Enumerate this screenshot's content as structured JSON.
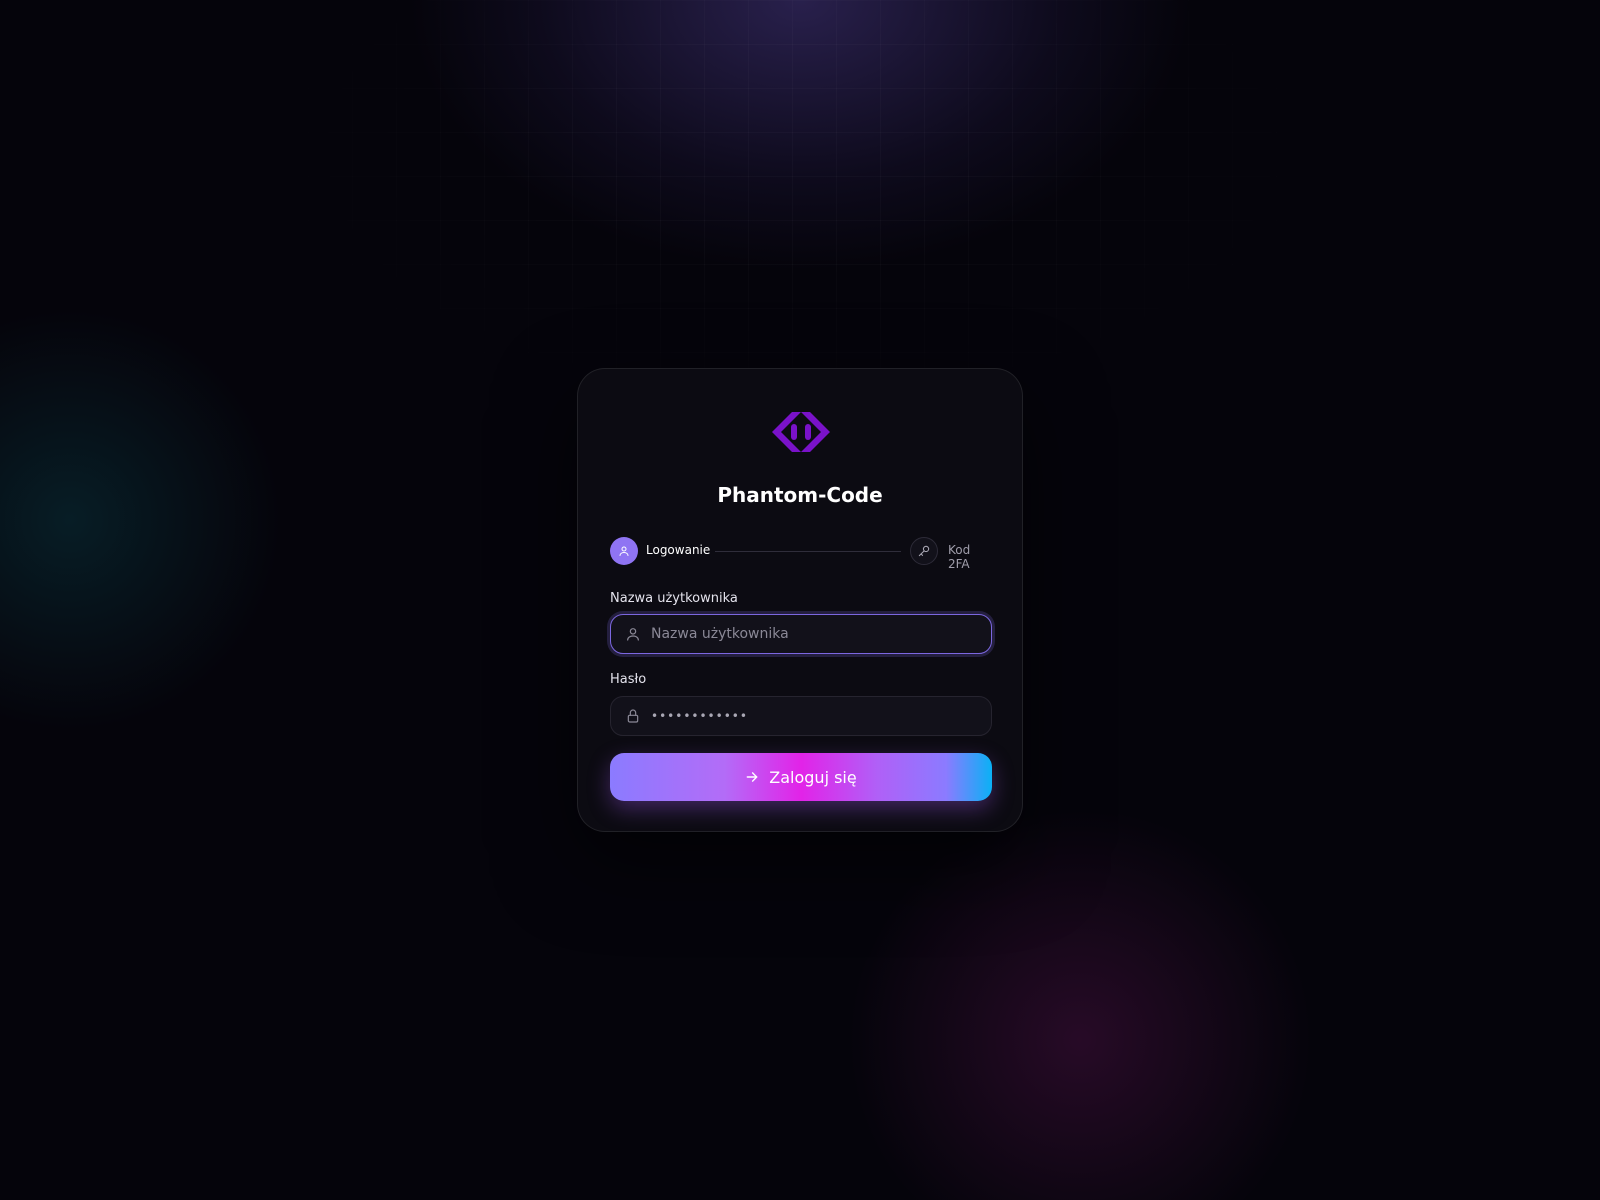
{
  "app": {
    "title": "Phantom-Code",
    "logo_icon": "code-brackets-logo",
    "accent_color": "#7a12c9"
  },
  "steps": [
    {
      "label": "Logowanie",
      "icon": "user-icon",
      "active": true
    },
    {
      "label": "Kod 2FA",
      "icon": "key-icon",
      "active": false
    }
  ],
  "form": {
    "username": {
      "label": "Nazwa użytkownika",
      "placeholder": "Nazwa użytkownika",
      "value": "",
      "icon": "user-icon"
    },
    "password": {
      "label": "Hasło",
      "value": "••••••••••••",
      "icon": "lock-icon"
    },
    "submit": {
      "label": "Zaloguj się",
      "icon": "arrow-right-icon"
    }
  }
}
